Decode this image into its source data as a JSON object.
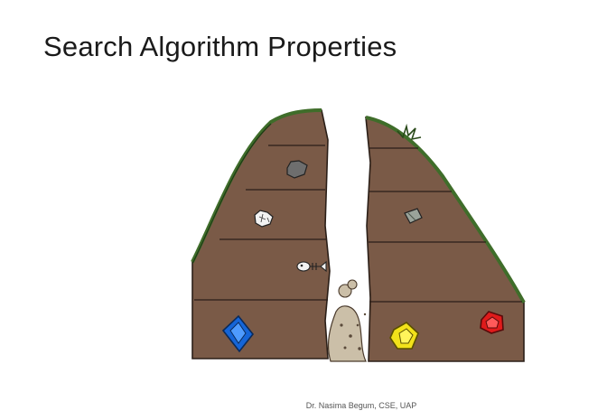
{
  "slide": {
    "title": "Search Algorithm Properties",
    "footer": "Dr. Nasima Begum, CSE, UAP"
  },
  "illustration": {
    "ground_color": "#7a5a47",
    "grass_color": "#3f6d2a",
    "gap_debris_color": "#cbbfa8",
    "items": [
      {
        "icon": "rock-icon",
        "color": "#6e6e6e"
      },
      {
        "icon": "crumpled-paper-icon",
        "color": "#f2f2f2"
      },
      {
        "icon": "fish-bone-icon",
        "color": "#f2f2f2"
      },
      {
        "icon": "can-icon",
        "color": "#9aa39a"
      },
      {
        "icon": "blue-gem-icon",
        "color": "#1565d8"
      },
      {
        "icon": "yellow-gem-icon",
        "color": "#f2e21a"
      },
      {
        "icon": "red-gem-icon",
        "color": "#e01b1b"
      }
    ]
  }
}
